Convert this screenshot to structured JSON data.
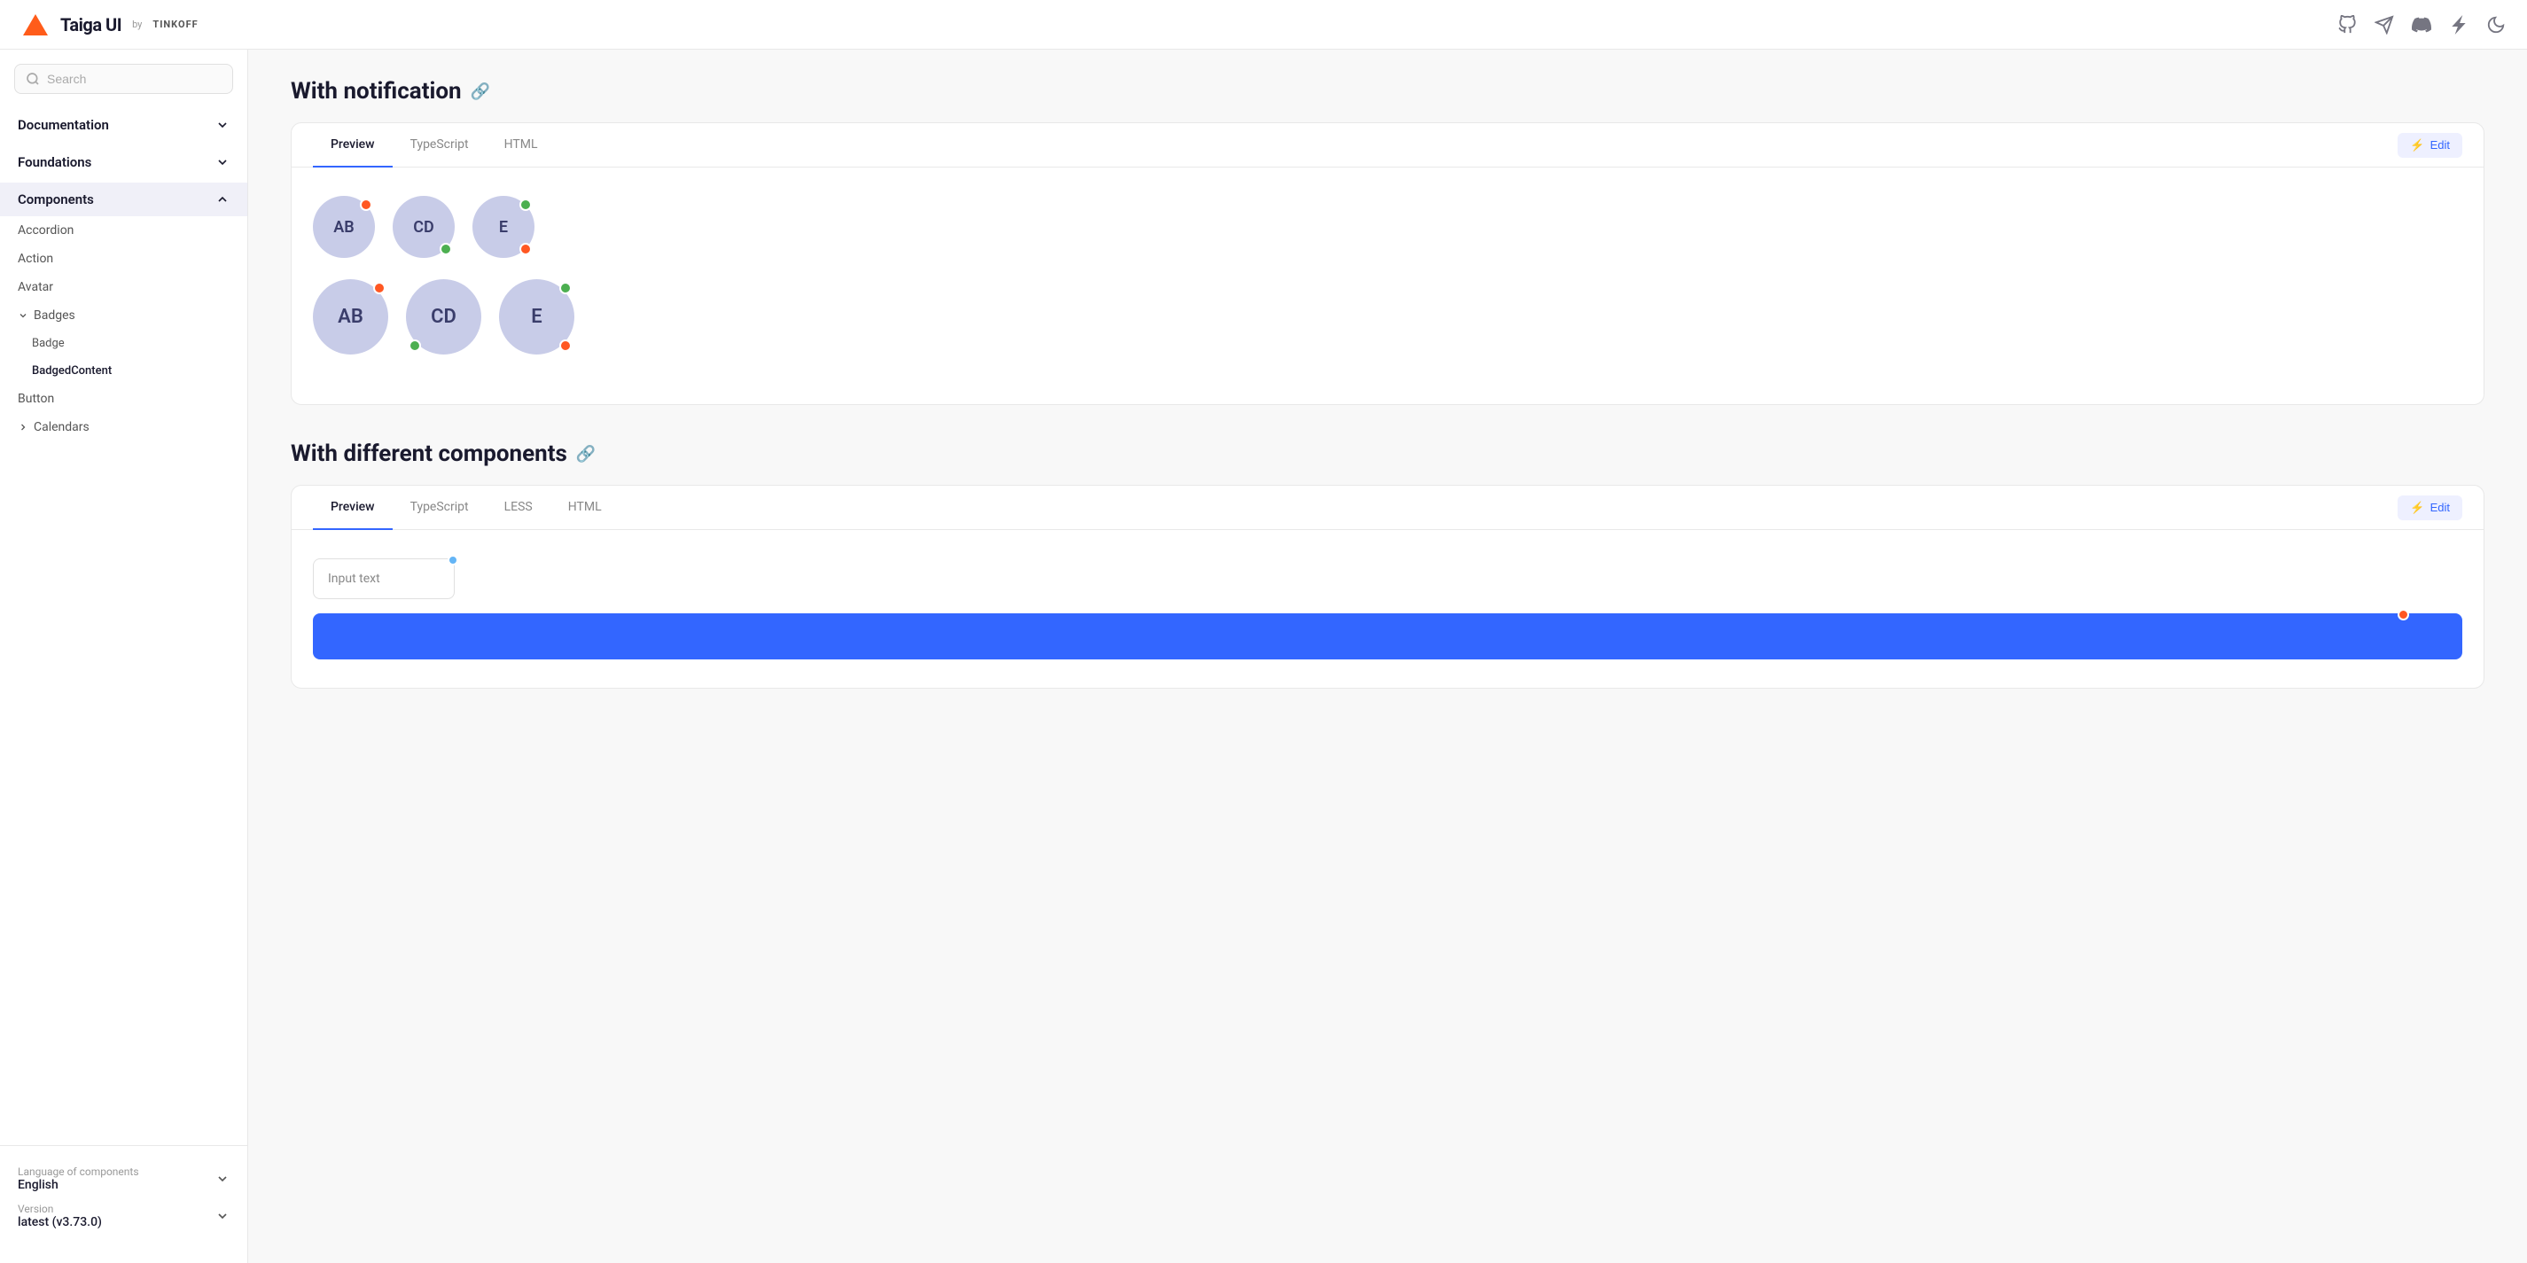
{
  "header": {
    "logo_title": "Taiga UI",
    "logo_by": "by",
    "logo_brand": "TINKOFF"
  },
  "sidebar": {
    "search_placeholder": "Search",
    "nav": [
      {
        "id": "documentation",
        "label": "Documentation",
        "expanded": false
      },
      {
        "id": "foundations",
        "label": "Foundations",
        "expanded": false
      },
      {
        "id": "components",
        "label": "Components",
        "expanded": true
      }
    ],
    "components": [
      {
        "id": "accordion",
        "label": "Accordion"
      },
      {
        "id": "action",
        "label": "Action"
      },
      {
        "id": "avatar",
        "label": "Avatar"
      },
      {
        "id": "badges",
        "label": "Badges",
        "group": true,
        "expanded": true
      },
      {
        "id": "badge",
        "label": "Badge",
        "sub": true
      },
      {
        "id": "badged-content",
        "label": "BadgedContent",
        "sub": true
      },
      {
        "id": "button",
        "label": "Button"
      },
      {
        "id": "calendars",
        "label": "Calendars",
        "group": true,
        "expanded": false
      }
    ],
    "footer": {
      "language_label": "Language of components",
      "language_value": "English",
      "version_label": "Version",
      "version_value": "latest (v3.73.0)"
    }
  },
  "main": {
    "section1": {
      "title": "With notification",
      "tabs": [
        "Preview",
        "TypeScript",
        "HTML"
      ],
      "active_tab": "Preview",
      "edit_label": "Edit",
      "avatars_row1": [
        {
          "initials": "AB",
          "badge_pos": "top-right",
          "badge_color": "orange"
        },
        {
          "initials": "CD",
          "badge_pos": "bottom-right",
          "badge_color": "green"
        },
        {
          "initials": "E",
          "badge_pos": "top-right",
          "badge_color": "green",
          "badge2_pos": "bottom-right",
          "badge2_color": "orange"
        }
      ],
      "avatars_row2": [
        {
          "initials": "AB",
          "badge_pos": "top-right",
          "badge_color": "orange",
          "large": true
        },
        {
          "initials": "CD",
          "badge_pos": "bottom-left",
          "badge_color": "green",
          "large": true
        },
        {
          "initials": "E",
          "badge_pos": "top-right",
          "badge_color": "green",
          "badge2_pos": "bottom-right",
          "badge2_color": "orange",
          "large": true
        }
      ]
    },
    "section2": {
      "title": "With different components",
      "tabs": [
        "Preview",
        "TypeScript",
        "LESS",
        "HTML"
      ],
      "active_tab": "Preview",
      "edit_label": "Edit",
      "input_placeholder": "Input text",
      "input_badge_color": "#64b5f6",
      "action_badge_color": "#ff5722"
    }
  }
}
